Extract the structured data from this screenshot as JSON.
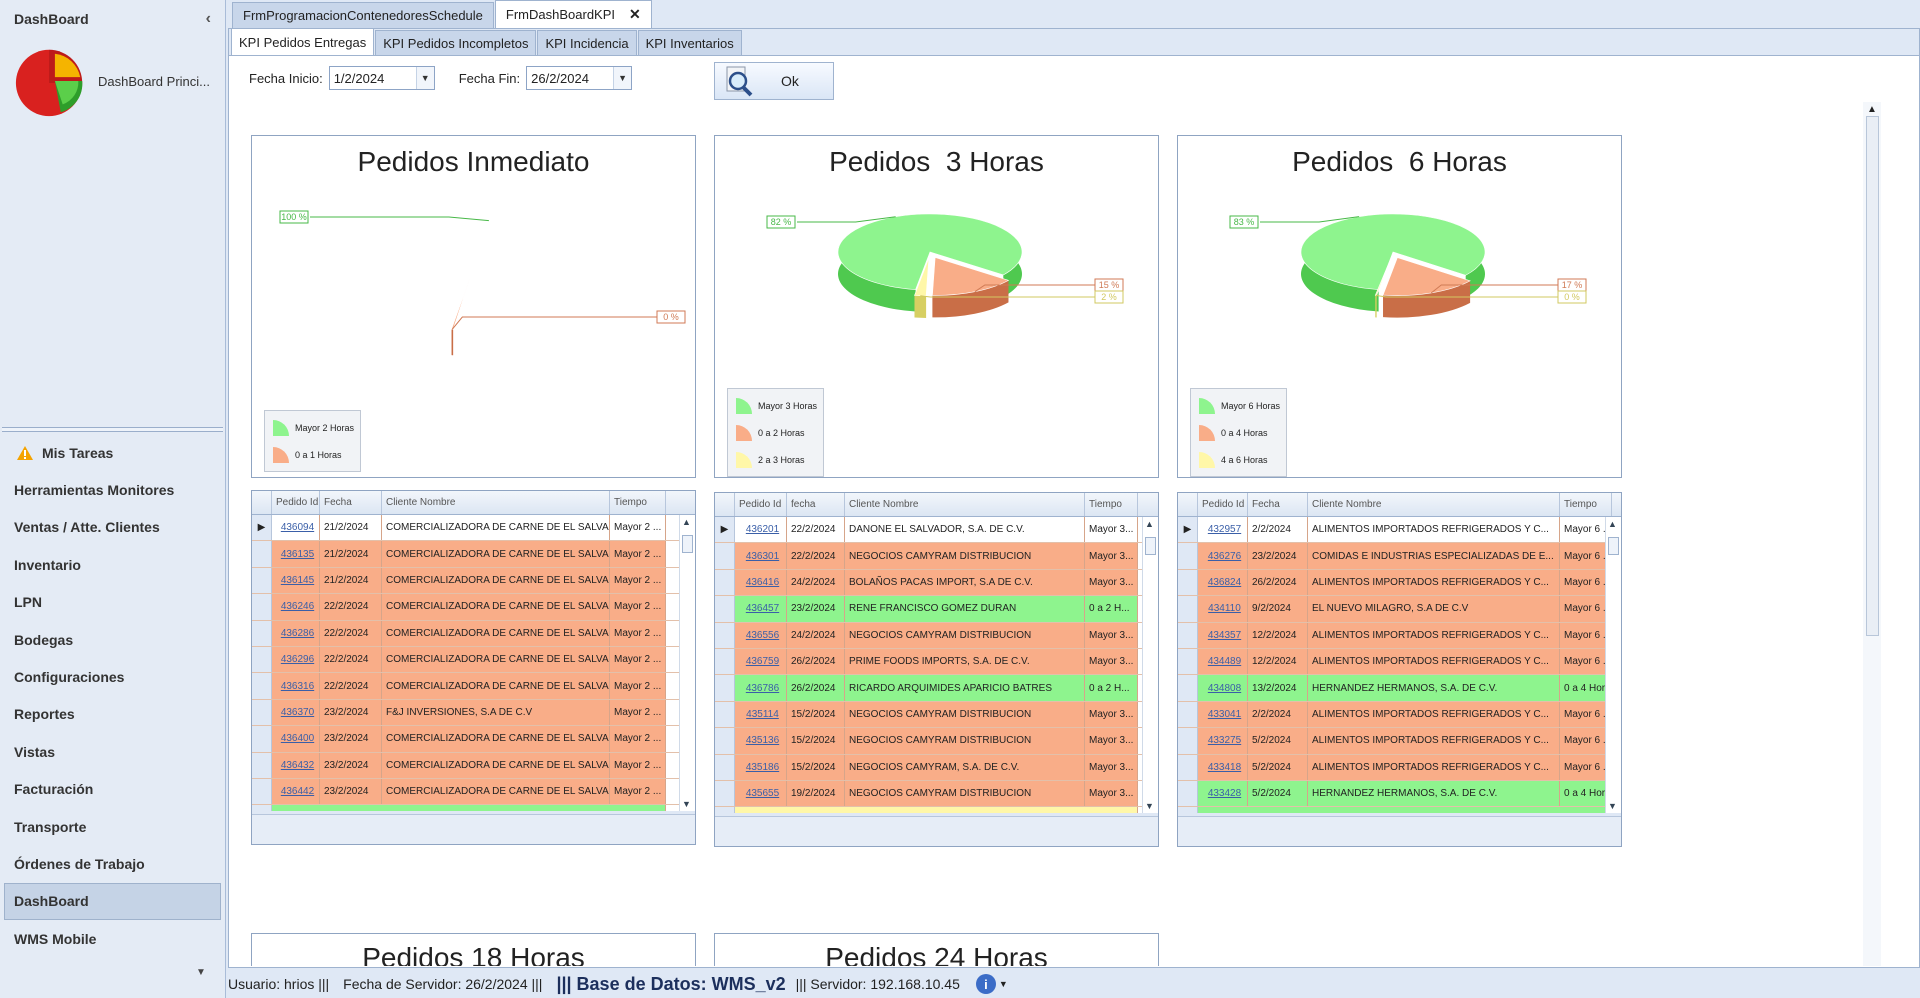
{
  "sidebar": {
    "title": "DashBoard",
    "collapse_icon": "‹",
    "dashboard_item": "DashBoard Princi...",
    "nav": [
      {
        "label": "Mis Tareas",
        "icon": "warning-icon"
      },
      {
        "label": "Herramientas Monitores"
      },
      {
        "label": "Ventas / Atte. Clientes"
      },
      {
        "label": "Inventario"
      },
      {
        "label": "LPN"
      },
      {
        "label": "Bodegas"
      },
      {
        "label": "Configuraciones"
      },
      {
        "label": "Reportes"
      },
      {
        "label": "Vistas"
      },
      {
        "label": "Facturación"
      },
      {
        "label": "Transporte"
      },
      {
        "label": "Órdenes de Trabajo"
      },
      {
        "label": "DashBoard",
        "active": true
      },
      {
        "label": "WMS Mobile"
      }
    ]
  },
  "outer_tabs": {
    "tab1": "FrmProgramacionContenedoresSchedule",
    "tab2": "FrmDashBoardKPI",
    "close": "✕"
  },
  "inner_tabs": [
    "KPI Pedidos Entregas",
    "KPI Pedidos Incompletos",
    "KPI Incidencia",
    "KPI Inventarios"
  ],
  "filters": {
    "fecha_inicio_label": "Fecha Inicio:",
    "fecha_inicio": "1/2/2024",
    "fecha_fin_label": "Fecha Fin:",
    "fecha_fin": "26/2/2024",
    "ok_label": "Ok"
  },
  "colors": {
    "green": "#8ef48e",
    "orange": "#f9ad88",
    "yellow": "#fff7a8"
  },
  "charts": [
    {
      "title": "Pedidos Inmediato",
      "chart_data": {
        "type": "pie",
        "labels": [
          "Mayor 2 Horas",
          "0 a 1 Horas"
        ],
        "values": [
          100,
          0
        ],
        "value_labels": [
          "100 %",
          "0 %"
        ]
      },
      "legend": [
        "Mayor 2 Horas",
        "0 a 1 Horas"
      ]
    },
    {
      "title": "Pedidos  3 Horas",
      "chart_data": {
        "type": "pie",
        "labels": [
          "Mayor 3 Horas",
          "0 a 2 Horas",
          "2 a 3 Horas"
        ],
        "values": [
          82,
          15,
          2
        ],
        "value_labels": [
          "82 %",
          "15 %",
          "2 %"
        ]
      },
      "legend": [
        "Mayor 3 Horas",
        "0 a 2 Horas",
        "2 a 3 Horas"
      ]
    },
    {
      "title": "Pedidos  6 Horas",
      "chart_data": {
        "type": "pie",
        "labels": [
          "Mayor 6 Horas",
          "0 a 4 Horas",
          "4 a 6 Horas"
        ],
        "values": [
          83,
          17,
          0
        ],
        "value_labels": [
          "83 %",
          "17 %",
          "0 %"
        ]
      },
      "legend": [
        "Mayor 6 Horas",
        "0 a 4 Horas",
        "4 a 6 Horas"
      ]
    }
  ],
  "grids": [
    {
      "headers": [
        "Pedido Id",
        "Fecha",
        "Cliente Nombre",
        "Tiempo"
      ],
      "rows": [
        {
          "id": "436094",
          "fecha": "21/2/2024",
          "cliente": "COMERCIALIZADORA DE CARNE DE EL SALVA...",
          "tiempo": "Mayor 2 ...",
          "color": "plain"
        },
        {
          "id": "436135",
          "fecha": "21/2/2024",
          "cliente": "COMERCIALIZADORA DE CARNE DE EL SALVA...",
          "tiempo": "Mayor 2 ...",
          "color": "orange"
        },
        {
          "id": "436145",
          "fecha": "21/2/2024",
          "cliente": "COMERCIALIZADORA DE CARNE DE EL SALVA...",
          "tiempo": "Mayor 2 ...",
          "color": "orange"
        },
        {
          "id": "436246",
          "fecha": "22/2/2024",
          "cliente": "COMERCIALIZADORA DE CARNE DE EL SALVA...",
          "tiempo": "Mayor 2 ...",
          "color": "orange"
        },
        {
          "id": "436286",
          "fecha": "22/2/2024",
          "cliente": "COMERCIALIZADORA DE CARNE DE EL SALVA...",
          "tiempo": "Mayor 2 ...",
          "color": "orange"
        },
        {
          "id": "436296",
          "fecha": "22/2/2024",
          "cliente": "COMERCIALIZADORA DE CARNE DE EL SALVA...",
          "tiempo": "Mayor 2 ...",
          "color": "orange"
        },
        {
          "id": "436316",
          "fecha": "22/2/2024",
          "cliente": "COMERCIALIZADORA DE CARNE DE EL SALVA...",
          "tiempo": "Mayor 2 ...",
          "color": "orange"
        },
        {
          "id": "436370",
          "fecha": "23/2/2024",
          "cliente": "F&J  INVERSIONES, S.A DE C.V",
          "tiempo": "Mayor 2 ...",
          "color": "orange"
        },
        {
          "id": "436400",
          "fecha": "23/2/2024",
          "cliente": "COMERCIALIZADORA DE CARNE DE EL SALVA...",
          "tiempo": "Mayor 2 ...",
          "color": "orange"
        },
        {
          "id": "436432",
          "fecha": "23/2/2024",
          "cliente": "COMERCIALIZADORA DE CARNE DE EL SALVA...",
          "tiempo": "Mayor 2 ...",
          "color": "orange"
        },
        {
          "id": "436442",
          "fecha": "23/2/2024",
          "cliente": "COMERCIALIZADORA DE CARNE DE EL SALVA...",
          "tiempo": "Mayor 2 ...",
          "color": "orange"
        }
      ]
    },
    {
      "headers": [
        "Pedido Id",
        "fecha",
        "Cliente Nombre",
        "Tiempo"
      ],
      "rows": [
        {
          "id": "436201",
          "fecha": "22/2/2024",
          "cliente": "DANONE EL SALVADOR, S.A. DE C.V.",
          "tiempo": "Mayor 3...",
          "color": "plain"
        },
        {
          "id": "436301",
          "fecha": "22/2/2024",
          "cliente": "NEGOCIOS CAMYRAM DISTRIBUCION",
          "tiempo": "Mayor 3...",
          "color": "orange"
        },
        {
          "id": "436416",
          "fecha": "24/2/2024",
          "cliente": "BOLAÑOS PACAS IMPORT, S.A DE C.V.",
          "tiempo": "Mayor 3...",
          "color": "orange"
        },
        {
          "id": "436457",
          "fecha": "23/2/2024",
          "cliente": "RENE FRANCISCO GOMEZ DURAN",
          "tiempo": "0 a 2 H...",
          "color": "green"
        },
        {
          "id": "436556",
          "fecha": "24/2/2024",
          "cliente": "NEGOCIOS CAMYRAM DISTRIBUCION",
          "tiempo": "Mayor 3...",
          "color": "orange"
        },
        {
          "id": "436759",
          "fecha": "26/2/2024",
          "cliente": "PRIME FOODS IMPORTS, S.A. DE C.V.",
          "tiempo": "Mayor 3...",
          "color": "orange"
        },
        {
          "id": "436786",
          "fecha": "26/2/2024",
          "cliente": "RICARDO ARQUIMIDES APARICIO BATRES",
          "tiempo": "0 a 2 H...",
          "color": "green"
        },
        {
          "id": "435114",
          "fecha": "15/2/2024",
          "cliente": "NEGOCIOS CAMYRAM DISTRIBUCION",
          "tiempo": "Mayor 3...",
          "color": "orange"
        },
        {
          "id": "435136",
          "fecha": "15/2/2024",
          "cliente": "NEGOCIOS CAMYRAM DISTRIBUCION",
          "tiempo": "Mayor 3...",
          "color": "orange"
        },
        {
          "id": "435186",
          "fecha": "15/2/2024",
          "cliente": "NEGOCIOS CAMYRAM, S.A. DE C.V.",
          "tiempo": "Mayor 3...",
          "color": "orange"
        },
        {
          "id": "435655",
          "fecha": "19/2/2024",
          "cliente": "NEGOCIOS CAMYRAM DISTRIBUCION",
          "tiempo": "Mayor 3...",
          "color": "orange"
        }
      ]
    },
    {
      "headers": [
        "Pedido Id",
        "Fecha",
        "Cliente Nombre",
        "Tiempo"
      ],
      "rows": [
        {
          "id": "432957",
          "fecha": "2/2/2024",
          "cliente": "ALIMENTOS IMPORTADOS REFRIGERADOS Y C...",
          "tiempo": "Mayor 6 ...",
          "color": "plain"
        },
        {
          "id": "436276",
          "fecha": "23/2/2024",
          "cliente": "COMIDAS E INDUSTRIAS ESPECIALIZADAS DE E...",
          "tiempo": "Mayor 6 ...",
          "color": "orange"
        },
        {
          "id": "436824",
          "fecha": "26/2/2024",
          "cliente": "ALIMENTOS IMPORTADOS REFRIGERADOS Y C...",
          "tiempo": "Mayor 6 ...",
          "color": "orange"
        },
        {
          "id": "434110",
          "fecha": "9/2/2024",
          "cliente": "EL NUEVO MILAGRO, S.A DE C.V",
          "tiempo": "Mayor 6 ...",
          "color": "orange"
        },
        {
          "id": "434357",
          "fecha": "12/2/2024",
          "cliente": "ALIMENTOS IMPORTADOS REFRIGERADOS Y C...",
          "tiempo": "Mayor 6 ...",
          "color": "orange"
        },
        {
          "id": "434489",
          "fecha": "12/2/2024",
          "cliente": "ALIMENTOS IMPORTADOS REFRIGERADOS Y C...",
          "tiempo": "Mayor 6 ...",
          "color": "orange"
        },
        {
          "id": "434808",
          "fecha": "13/2/2024",
          "cliente": "HERNANDEZ HERMANOS, S.A. DE C.V.",
          "tiempo": "0 a 4 Horas",
          "color": "green"
        },
        {
          "id": "433041",
          "fecha": "2/2/2024",
          "cliente": "ALIMENTOS IMPORTADOS REFRIGERADOS Y C...",
          "tiempo": "Mayor 6 ...",
          "color": "orange"
        },
        {
          "id": "433275",
          "fecha": "5/2/2024",
          "cliente": "ALIMENTOS IMPORTADOS REFRIGERADOS Y C...",
          "tiempo": "Mayor 6 ...",
          "color": "orange"
        },
        {
          "id": "433418",
          "fecha": "5/2/2024",
          "cliente": "ALIMENTOS IMPORTADOS REFRIGERADOS Y C...",
          "tiempo": "Mayor 6 ...",
          "color": "orange"
        },
        {
          "id": "433428",
          "fecha": "5/2/2024",
          "cliente": "HERNANDEZ HERMANOS, S.A. DE C.V.",
          "tiempo": "0 a 4 Horas",
          "color": "green"
        }
      ]
    }
  ],
  "partial_charts": [
    "Pedidos 18 Horas",
    "Pedidos 24 Horas"
  ],
  "status": {
    "usuario": "Usuario: hrios |||",
    "fecha": "Fecha de Servidor: 26/2/2024 |||",
    "db": "||| Base de Datos: WMS_v2",
    "servidor": "||| Servidor: 192.168.10.45",
    "info_icon": "i"
  }
}
